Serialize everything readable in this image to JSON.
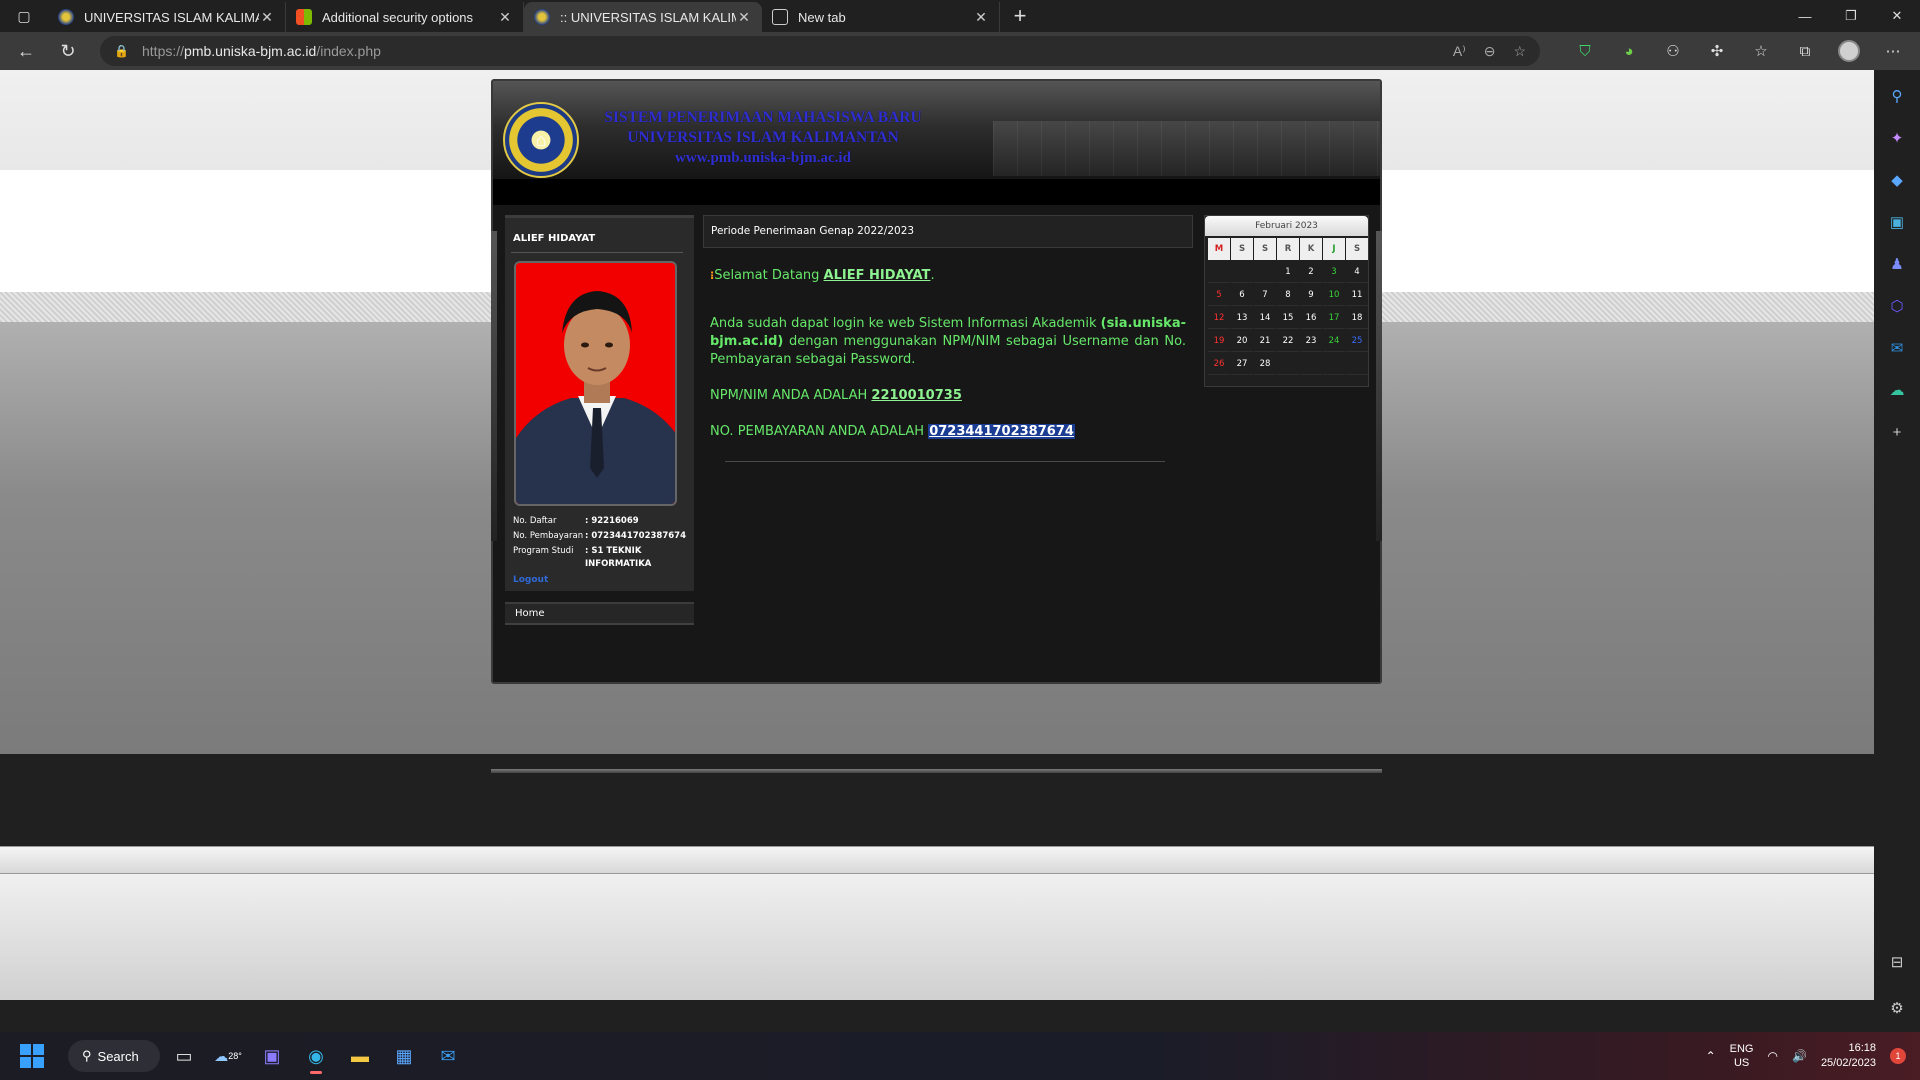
{
  "browser": {
    "tabs": [
      {
        "title": "UNIVERSITAS ISLAM KALIMANTAN",
        "favicon": "uniska-logo-icon",
        "active": false
      },
      {
        "title": "Additional security options",
        "favicon": "microsoft-logo-icon",
        "active": false
      },
      {
        "title": ":: UNIVERSITAS ISLAM KALIMAN",
        "favicon": "uniska-logo-icon",
        "active": true
      },
      {
        "title": "New tab",
        "favicon": "new-tab-icon",
        "active": false
      }
    ],
    "url_scheme": "https://",
    "url_host": "pmb.uniska-bjm.ac.id",
    "url_path": "/index.php"
  },
  "site": {
    "header": {
      "line1": "SISTEM PENERIMAAN MAHASISWA BARU",
      "line2": "UNIVERSITAS ISLAM KALIMANTAN",
      "line3": "www.pmb.uniska-bjm.ac.id"
    },
    "profile": {
      "name": "ALIEF HIDAYAT",
      "fields": [
        {
          "label": "No. Daftar",
          "value": ": 92216069"
        },
        {
          "label": "No. Pembayaran",
          "value": ": 0723441702387674"
        },
        {
          "label": "Program Studi",
          "value": ": S1 TEKNIK INFORMATIKA"
        }
      ],
      "logout": "Logout"
    },
    "menu": {
      "home": "Home"
    },
    "period": "Periode Penerimaan Genap 2022/2023",
    "content": {
      "welcome_prefix": "Selamat Datang ",
      "welcome_name": "ALIEF HIDAYAT",
      "welcome_suffix": ".",
      "login_text_1": "Anda sudah dapat login ke web Sistem Informasi Akademik ",
      "login_site": "(sia.uniska-bjm.ac.id)",
      "login_text_2": " dengan menggunakan NPM/NIM sebagai Username dan No. Pembayaran sebagai Password.",
      "npm_label": "NPM/NIM ANDA ADALAH ",
      "npm_value": "2210010735",
      "payment_label": "NO. PEMBAYARAN ANDA ADALAH ",
      "payment_value": "0723441702387674"
    },
    "calendar": {
      "title": "Februari 2023",
      "weekdays": [
        "M",
        "S",
        "S",
        "R",
        "K",
        "J",
        "S"
      ],
      "weeks": [
        [
          "",
          "",
          "",
          "1",
          "2",
          "3",
          "4"
        ],
        [
          "5",
          "6",
          "7",
          "8",
          "9",
          "10",
          "11"
        ],
        [
          "12",
          "13",
          "14",
          "15",
          "16",
          "17",
          "18"
        ],
        [
          "19",
          "20",
          "21",
          "22",
          "23",
          "24",
          "25"
        ],
        [
          "26",
          "27",
          "28",
          "",
          "",
          "",
          ""
        ]
      ],
      "today": "25"
    }
  },
  "taskbar": {
    "search_label": "Search",
    "weather": "28°",
    "lang_top": "ENG",
    "lang_bottom": "US",
    "time": "16:18",
    "date": "25/02/2023",
    "notification_count": "1"
  },
  "colors": {
    "link_green": "#66e86a",
    "header_blue": "#2f2ed0",
    "selection": "#1a3c92"
  }
}
